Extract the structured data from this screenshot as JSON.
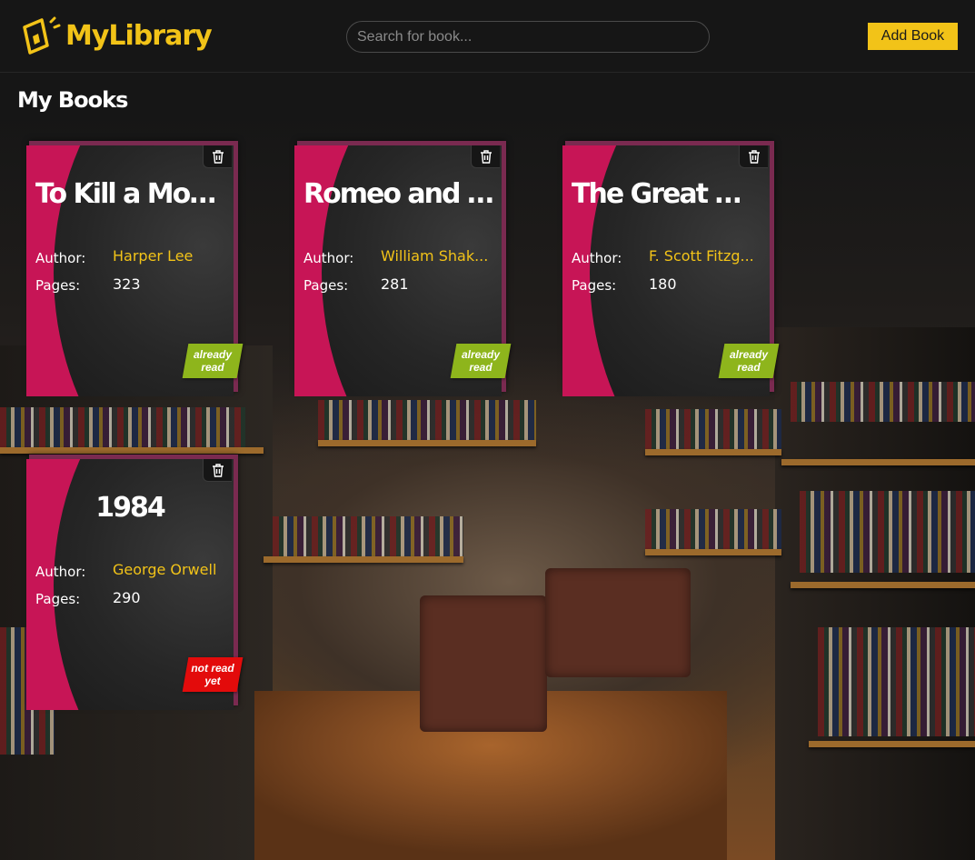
{
  "header": {
    "logo_text": "MyLibrary",
    "search_placeholder": "Search for book...",
    "search_value": "",
    "add_button_label": "Add Book"
  },
  "main": {
    "title": "My Books",
    "labels": {
      "author": "Author:",
      "pages": "Pages:"
    },
    "books": [
      {
        "title": "To Kill a Mocki...",
        "author": "Harper Lee",
        "pages": "323",
        "status": "already read"
      },
      {
        "title": "Romeo and Ju...",
        "author": "William Shak...",
        "pages": "281",
        "status": "already read"
      },
      {
        "title": "The Great Gat...",
        "author": "F. Scott Fitzg...",
        "pages": "180",
        "status": "already read"
      },
      {
        "title": "1984",
        "author": "George Orwell",
        "pages": "290",
        "status": "not read yet"
      }
    ]
  },
  "colors": {
    "accent": "#f2c318",
    "card_pink": "#c71556",
    "read_badge": "#8eb51c",
    "unread_badge": "#e30b0b"
  },
  "icons": [
    "book-logo-icon",
    "trash-icon"
  ]
}
